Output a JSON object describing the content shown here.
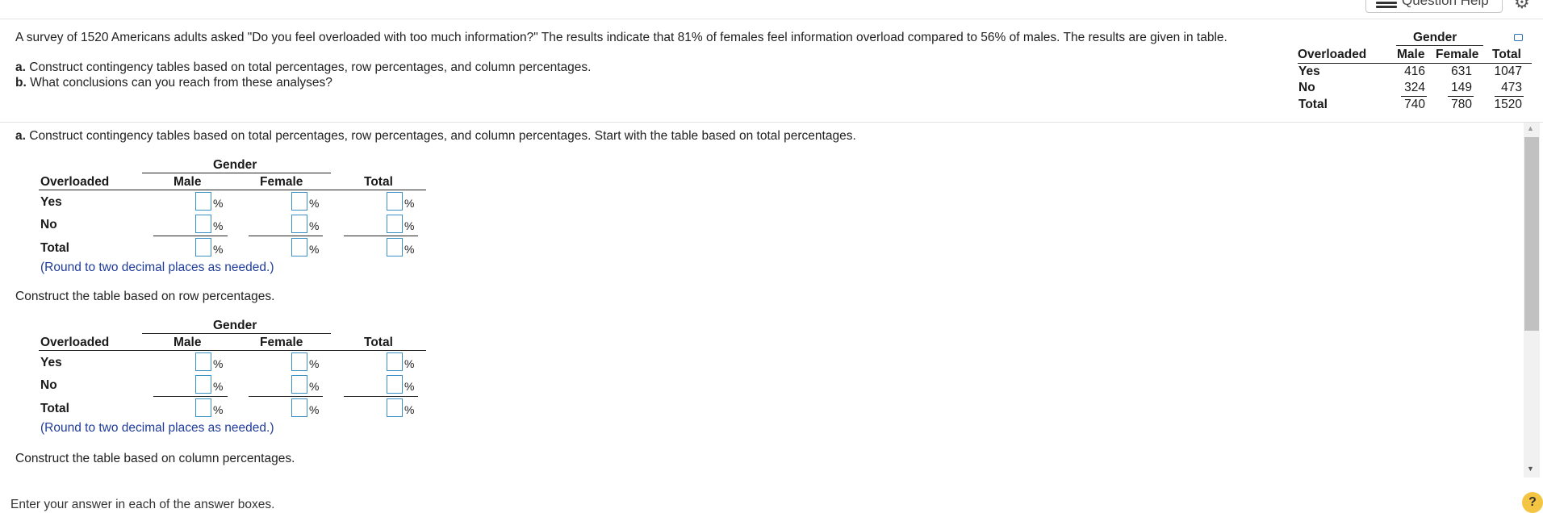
{
  "toolbar": {
    "question_help_label": "Question Help",
    "settings_icon": "gear-icon",
    "help_icon": "list-icon"
  },
  "problem": {
    "intro": "A survey of 1520 Americans adults asked \"Do you feel overloaded with too much information?\" The results indicate that 81% of females feel information overload compared to 56% of males. The results are given in table.",
    "part_a_prefix": "a.",
    "part_a_text": "Construct contingency tables based on total percentages, row percentages, and column percentages.",
    "part_b_prefix": "b.",
    "part_b_text": "What conclusions can you reach from these analyses?"
  },
  "given_table": {
    "group_header": "Gender",
    "row_header": "Overloaded",
    "columns": [
      "Male",
      "Female",
      "Total"
    ],
    "rows": [
      {
        "label": "Yes",
        "values": [
          "416",
          "631",
          "1047"
        ]
      },
      {
        "label": "No",
        "values": [
          "324",
          "149",
          "473"
        ]
      },
      {
        "label": "Total",
        "values": [
          "740",
          "780",
          "1520"
        ]
      }
    ]
  },
  "work": {
    "instruction_a_prefix": "a.",
    "instruction_a_text": "Construct contingency tables based on total percentages, row percentages, and column percentages. Start with the table based on total percentages.",
    "table_total": {
      "group_header": "Gender",
      "row_header": "Overloaded",
      "columns": [
        "Male",
        "Female",
        "Total"
      ],
      "rows": [
        "Yes",
        "No",
        "Total"
      ],
      "unit": "%",
      "hint": "(Round to two decimal places as needed.)"
    },
    "row_instruction": "Construct the table based on row percentages.",
    "table_row": {
      "group_header": "Gender",
      "row_header": "Overloaded",
      "columns": [
        "Male",
        "Female",
        "Total"
      ],
      "rows": [
        "Yes",
        "No",
        "Total"
      ],
      "unit": "%",
      "hint": "(Round to two decimal places as needed.)"
    },
    "column_instruction": "Construct the table based on column percentages."
  },
  "footer": {
    "enter_answer": "Enter your answer in each of the answer boxes.",
    "help_symbol": "?"
  },
  "colors": {
    "input_border": "#3a8fc4",
    "hint": "#1f3c9a",
    "help_badge": "#f4c542"
  }
}
